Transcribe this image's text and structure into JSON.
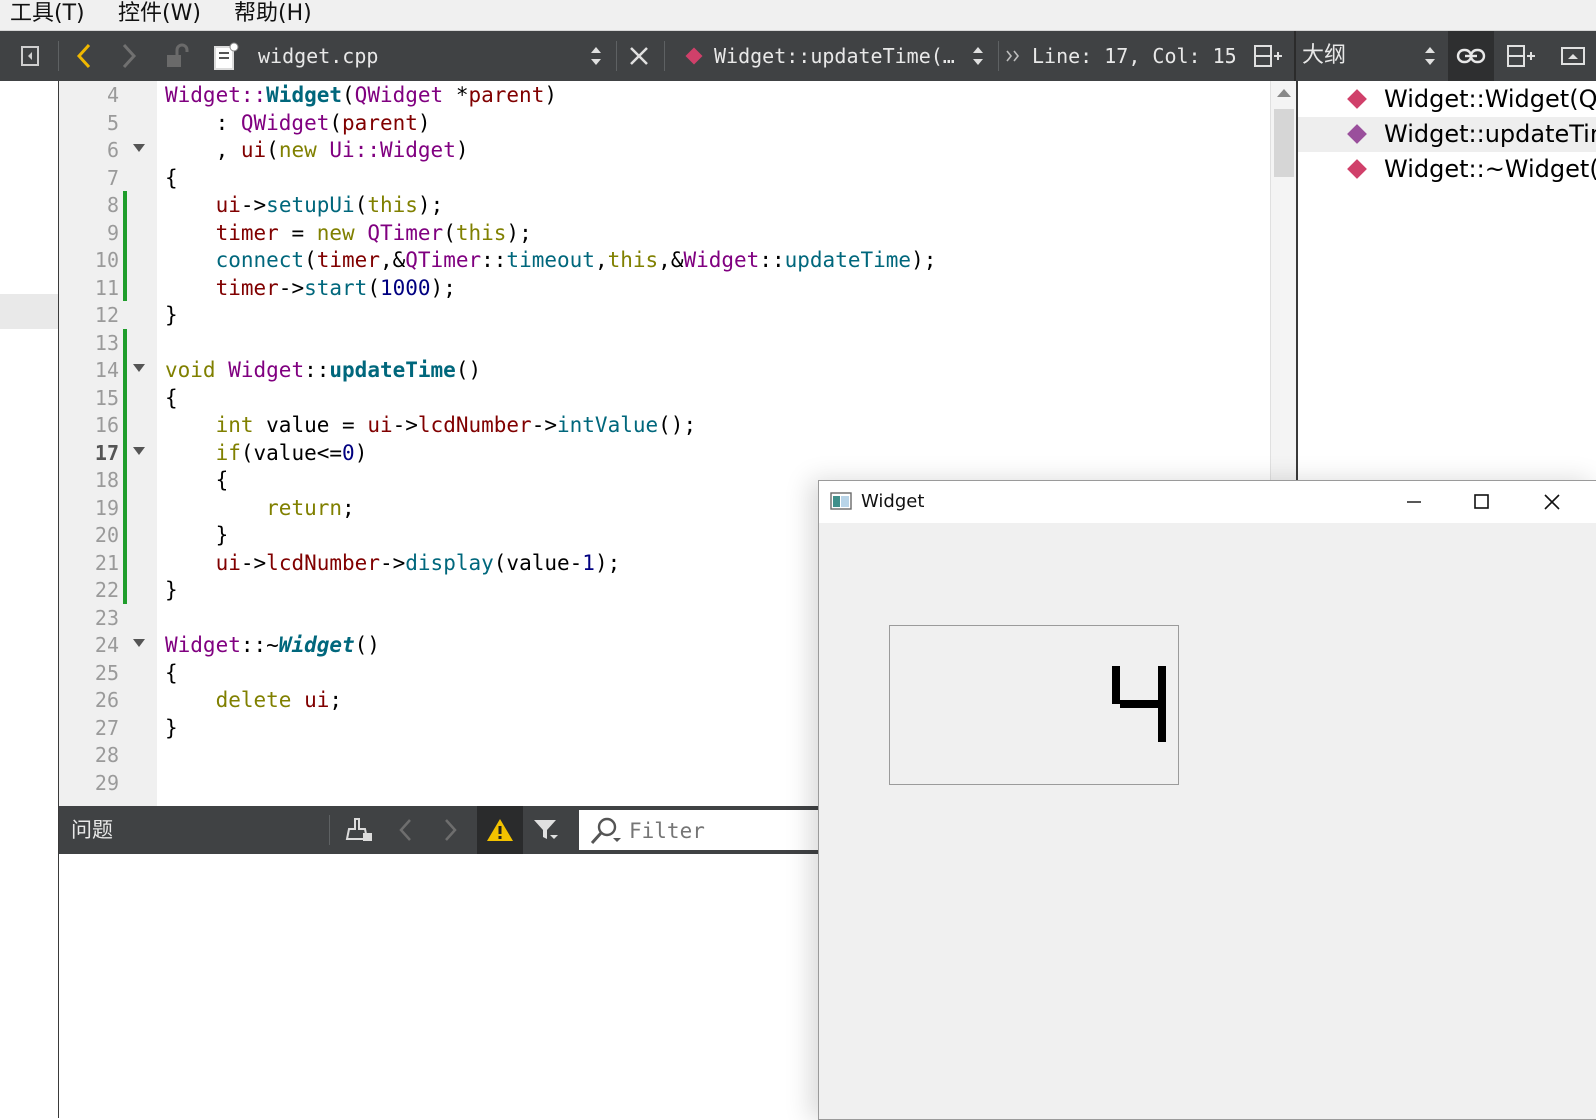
{
  "menu": {
    "items": [
      "工具(T)",
      "控件(W)",
      "帮助(H)"
    ]
  },
  "toolbar": {
    "file_name": "widget.cpp",
    "symbol": "Widget::updateTime(…",
    "position": "Line: 17, Col: 15",
    "outline_title": "大纲"
  },
  "editor": {
    "line_numbers": [
      "4",
      "5",
      "6",
      "7",
      "8",
      "9",
      "10",
      "11",
      "12",
      "13",
      "14",
      "15",
      "16",
      "17",
      "18",
      "19",
      "20",
      "21",
      "22",
      "23",
      "24",
      "25",
      "26",
      "27",
      "28",
      "29"
    ],
    "current_line": "17"
  },
  "outline": {
    "items": [
      {
        "label": "Widget::Widget(QWidget *parent)",
        "color": "#d0406a"
      },
      {
        "label": "Widget::updateTime()",
        "color": "#9a4f9c"
      },
      {
        "label": "Widget::~Widget()",
        "color": "#d0406a"
      }
    ]
  },
  "issues": {
    "title": "问题",
    "filter_placeholder": "Filter"
  },
  "widget_window": {
    "title": "Widget",
    "lcd_value": "4"
  },
  "colors": {
    "toolbar_bg": "#404244",
    "change_bar": "#1f9d2b",
    "keyword": "#808000",
    "type": "#800080",
    "function": "#00677c",
    "member": "#800000",
    "number": "#000080"
  }
}
